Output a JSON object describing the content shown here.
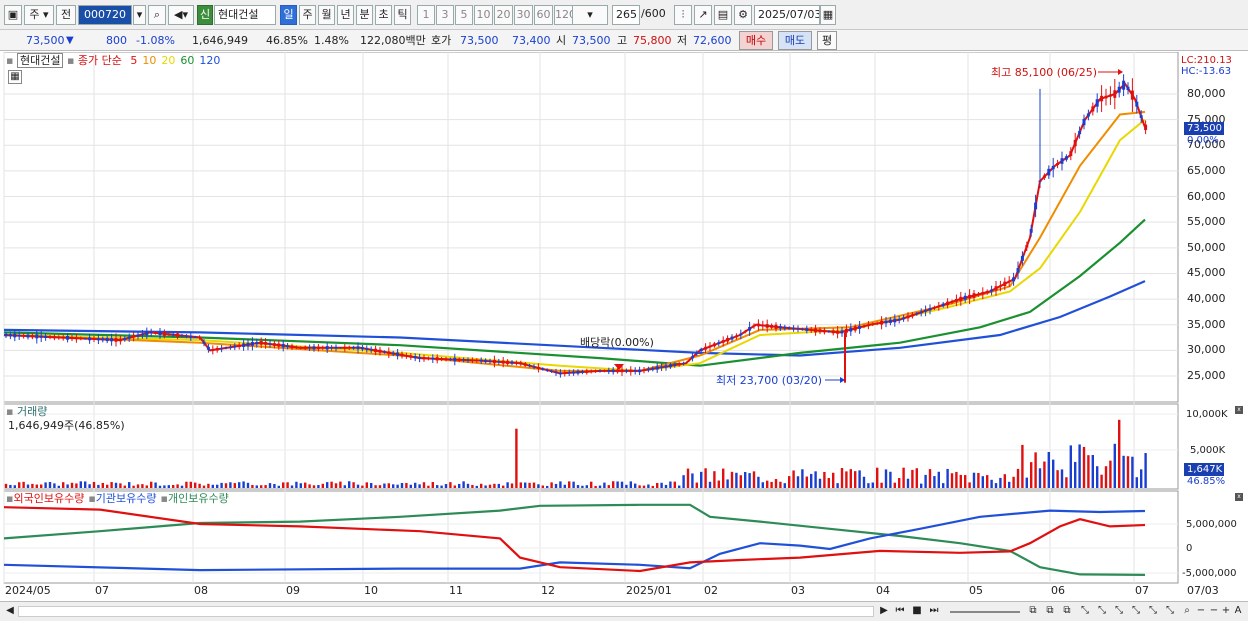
{
  "toolbar": {
    "period_unit": "주",
    "prev_label": "전",
    "stock_code": "000720",
    "stock_badge": "신",
    "stock_name": "현대건설",
    "periods": [
      "일",
      "주",
      "월",
      "년",
      "분",
      "초",
      "틱"
    ],
    "intervals": [
      "1",
      "3",
      "5",
      "10",
      "20",
      "30",
      "60",
      "120"
    ],
    "count": "265",
    "count_total": "/600",
    "date": "2025/07/03"
  },
  "quote": {
    "price": "73,500",
    "change": "800",
    "change_pct": "-1.08%",
    "volume": "1,646,949",
    "vol_ratio": "46.85%",
    "turnover_ratio": "1.48%",
    "amount": "122,080백만",
    "hoga_label": "호가",
    "ask": "73,500",
    "bid": "73,400",
    "open_label": "시",
    "open": "73,500",
    "high_label": "고",
    "high": "75,800",
    "low_label": "저",
    "low": "72,600",
    "buy_label": "매수",
    "sell_label": "매도",
    "eval_label": "평"
  },
  "legend": {
    "stock": "현대건설",
    "ma_label": "종가 단순",
    "ma": [
      {
        "period": "5",
        "color": "#e01010"
      },
      {
        "period": "10",
        "color": "#f08c00"
      },
      {
        "period": "20",
        "color": "#e8d800"
      },
      {
        "period": "60",
        "color": "#1a9030"
      },
      {
        "period": "120",
        "color": "#2050d8"
      }
    ]
  },
  "annotations": {
    "high": "최고 85,100 (06/25)",
    "low": "최저 23,700 (03/20)",
    "dividend": "배당락(0.00%)"
  },
  "price_axis": {
    "labels": [
      "80,000",
      "75,000",
      "70,000",
      "65,000",
      "60,000",
      "55,000",
      "50,000",
      "45,000",
      "40,000",
      "35,000",
      "30,000",
      "25,000"
    ],
    "lc": "LC:210.13",
    "hc": "HC:-13.63",
    "current": "73,500",
    "pct": "0.00%"
  },
  "volume_panel": {
    "title": "거래량",
    "value": "1,646,949주(46.85%)",
    "axis": [
      "10,000K",
      "5,000K"
    ],
    "current": "1,647K",
    "pct": "46.85%"
  },
  "holdings_panel": {
    "series": [
      {
        "name": "외국인보유수량",
        "color": "#e01010"
      },
      {
        "name": "기관보유수량",
        "color": "#2050d8"
      },
      {
        "name": "개인보유수량",
        "color": "#2e8b57"
      }
    ],
    "axis": [
      "5,000,000",
      "0",
      "-5,000,000"
    ]
  },
  "x_axis": [
    "2024/05",
    "07",
    "08",
    "09",
    "10",
    "11",
    "12",
    "2025/01",
    "02",
    "03",
    "04",
    "05",
    "06",
    "07",
    "07/03"
  ],
  "chart_data": {
    "type": "candlestick",
    "x_range": [
      "2024/05",
      "2025/07/03"
    ],
    "price_ylim": [
      23000,
      87000
    ],
    "ma_end_values": {
      "5": 76000,
      "10": 76500,
      "20": 75000,
      "60": 55500,
      "120": 43500
    },
    "price_markers": {
      "high": 85100,
      "low": 23700
    },
    "volume_ylim_K": [
      0,
      11000
    ],
    "holdings_ylim": [
      -6000000,
      9000000
    ],
    "holdings_end_values": {
      "외국인보유수량": 4800000,
      "기관보유수량": 7700000,
      "개인보유수량": -5600000
    }
  }
}
